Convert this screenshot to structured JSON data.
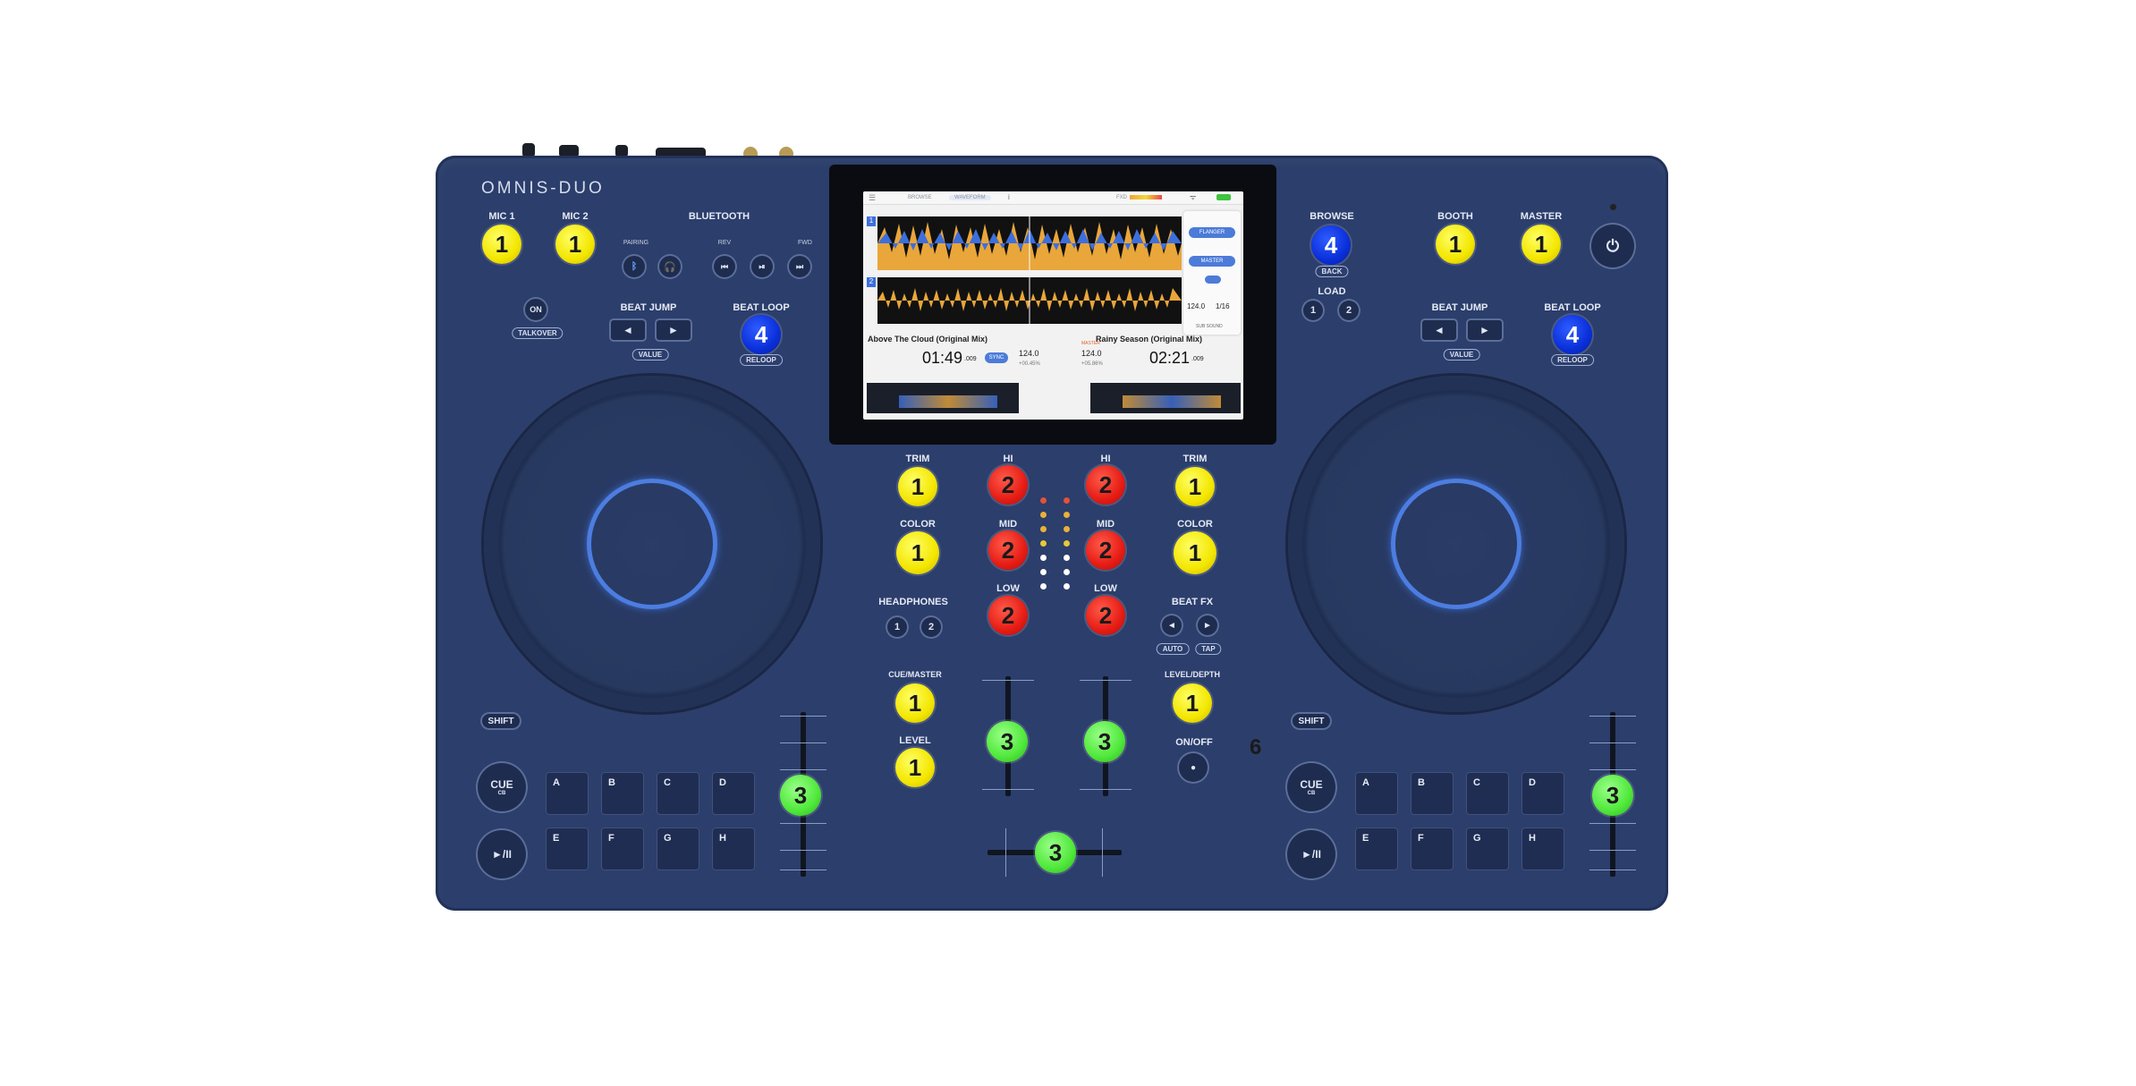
{
  "brand": "OMNIS-DUO",
  "left": {
    "mic1": "MIC 1",
    "mic2": "MIC 2",
    "bluetooth": "BLUETOOTH",
    "bt_pairing": "PAIRING",
    "bt_rev": "REV",
    "bt_fwd": "FWD",
    "on": "ON",
    "talkover": "TALKOVER",
    "beat_jump": "BEAT JUMP",
    "value": "VALUE",
    "beat_loop": "BEAT LOOP",
    "reloop": "RELOOP",
    "shift": "SHIFT",
    "cue": "CUE",
    "cue_sub": "CB",
    "play": "►/II"
  },
  "right": {
    "browse": "BROWSE",
    "back": "BACK",
    "load": "LOAD",
    "load1": "1",
    "load2": "2",
    "booth": "BOOTH",
    "master": "MASTER",
    "beat_jump": "BEAT JUMP",
    "value": "VALUE",
    "beat_loop": "BEAT LOOP",
    "reloop": "RELOOP",
    "shift": "SHIFT",
    "cue": "CUE",
    "cue_sub": "CB",
    "play": "►/II"
  },
  "pads": [
    "A",
    "B",
    "C",
    "D",
    "E",
    "F",
    "G",
    "H"
  ],
  "mixer": {
    "trim": "TRIM",
    "hi": "HI",
    "mid": "MID",
    "low": "LOW",
    "color": "COLOR",
    "headphones": "HEADPHONES",
    "hp1": "1",
    "hp2": "2",
    "beat_fx": "BEAT FX",
    "auto": "AUTO",
    "tap": "TAP",
    "cue_master": "CUE/MASTER",
    "level": "LEVEL",
    "level_depth": "LEVEL/DEPTH",
    "on_off": "ON/OFF"
  },
  "annotations": {
    "one": "1",
    "two": "2",
    "three": "3",
    "four": "4",
    "six": "6"
  },
  "screen": {
    "tab_browse": "BROWSE",
    "tab_waveform": "WAVEFORM",
    "fx": "FXD",
    "deck1": "1",
    "deck2": "2",
    "fx_flanger": "FLANGER",
    "fx_master": "MASTER",
    "fx_bpm": "124.0",
    "fx_beat": "1/16",
    "fx_sub": "SUB SOUND",
    "track1": "Above The Cloud (Original Mix)",
    "track2": "Rainy Season (Original Mix)",
    "time1": "01:49",
    "time1_ms": ".009",
    "time2": "02:21",
    "time2_ms": ".009",
    "sync": "SYNC",
    "bpm1": "124.0",
    "bpm2": "124.0",
    "pitch1": "+00.45%",
    "pitch2": "+05.86%",
    "master_tag": "MASTER"
  },
  "colors": {
    "body": "#2c3e6b",
    "knob_yellow": "#f3e600",
    "knob_red": "#e61c14",
    "knob_green": "#4fe83a",
    "knob_blue": "#0a2fd9",
    "jog_ring": "#4c7de0"
  }
}
